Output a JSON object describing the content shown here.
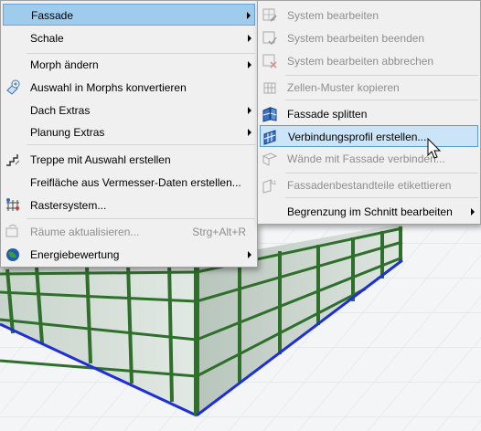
{
  "main_menu": {
    "items": [
      {
        "label": "Fassade",
        "submenu": true,
        "highlighted": true
      },
      {
        "label": "Schale",
        "submenu": true
      },
      {
        "label": "Morph ändern",
        "submenu": true
      },
      {
        "label": "Auswahl in Morphs konvertieren",
        "icon": "morph-convert-icon"
      },
      {
        "label": "Dach Extras",
        "submenu": true
      },
      {
        "label": "Planung Extras",
        "submenu": true
      },
      {
        "label": "Treppe mit Auswahl erstellen",
        "icon": "stair-icon"
      },
      {
        "label": "Freifläche aus Vermesser-Daten erstellen..."
      },
      {
        "label": "Rastersystem...",
        "icon": "grid-system-icon"
      },
      {
        "label": "Räume aktualisieren...",
        "shortcut": "Strg+Alt+R",
        "disabled": true,
        "icon": "zone-update-icon"
      },
      {
        "label": "Energiebewertung",
        "submenu": true,
        "icon": "globe-icon"
      }
    ]
  },
  "sub_menu": {
    "items": [
      {
        "label": "System bearbeiten",
        "disabled": true,
        "icon": "edit-system-icon"
      },
      {
        "label": "System bearbeiten beenden",
        "disabled": true,
        "icon": "edit-system-done-icon"
      },
      {
        "label": "System bearbeiten abbrechen",
        "disabled": true,
        "icon": "edit-system-cancel-icon"
      },
      {
        "label": "Zellen-Muster kopieren",
        "disabled": true,
        "icon": "copy-pattern-icon"
      },
      {
        "label": "Fassade splitten",
        "icon": "split-curtain-wall-icon"
      },
      {
        "label": "Verbindungsprofil erstellen...",
        "highlighted": true,
        "icon": "junction-profile-icon"
      },
      {
        "label": "Wände mit Fassade verbinden...",
        "disabled": true,
        "icon": "connect-walls-icon"
      },
      {
        "label": "Fassadenbestandteile etikettieren",
        "disabled": true,
        "icon": "label-components-icon"
      },
      {
        "label": "Begrenzung im Schnitt bearbeiten",
        "submenu": true
      }
    ]
  },
  "colors": {
    "menu_bg": "#f0f0f0",
    "highlight_bg": "#cce4f7",
    "highlight_border": "#5b9bd5",
    "disabled_text": "#8e8e8e",
    "facade_frame": "#2c6b2a",
    "glass": "#c9d6cc",
    "floor_line": "#1f2fd6"
  }
}
